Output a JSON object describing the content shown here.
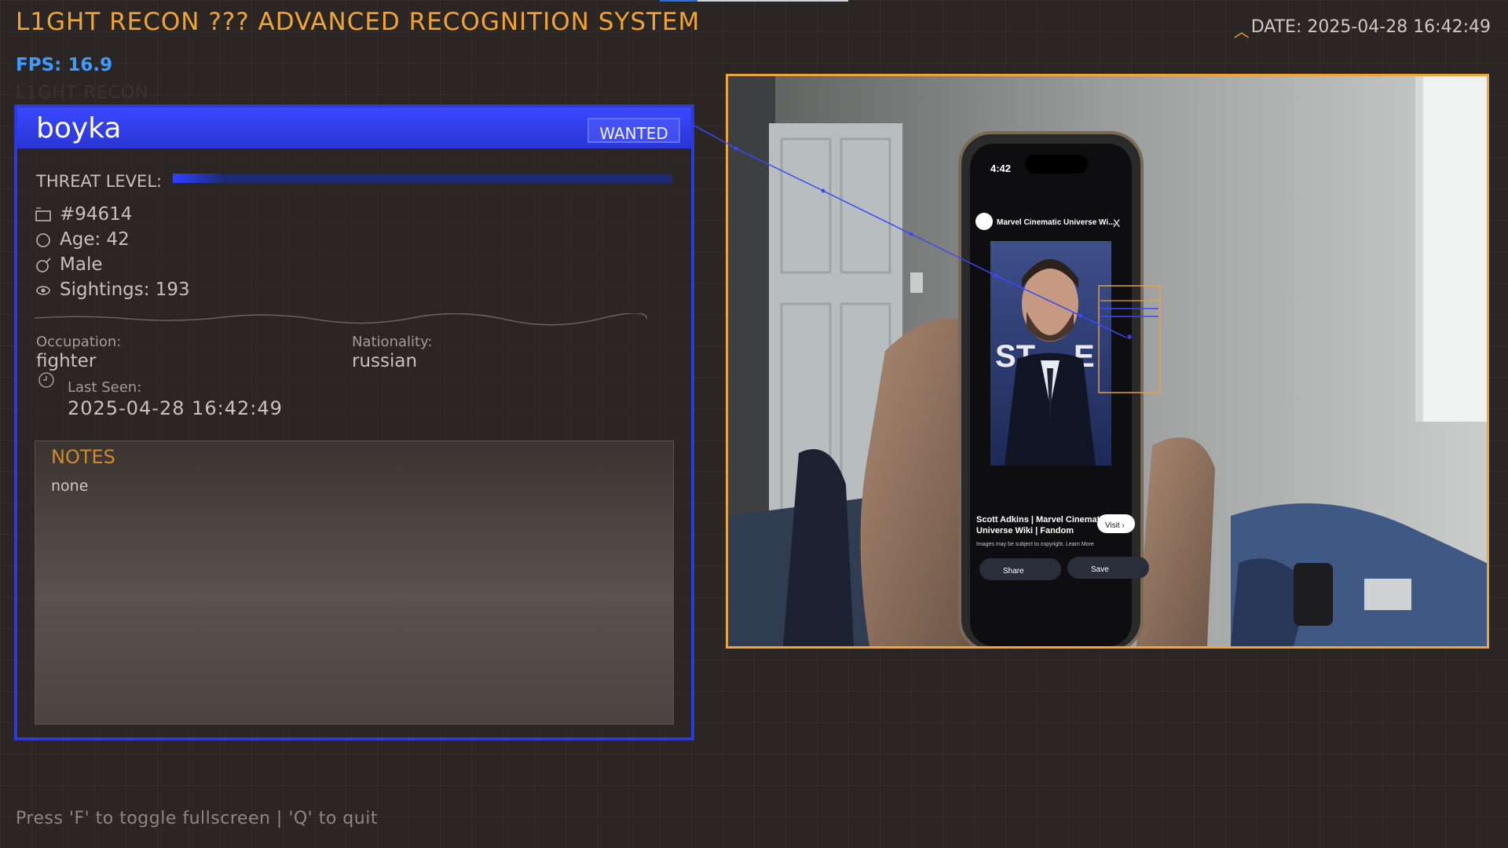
{
  "header": {
    "title": "L1GHT RECON ??? ADVANCED RECOGNITION SYSTEM",
    "date": "DATE: 2025-04-28 16:42:49"
  },
  "status": {
    "fps": "FPS: 16.9",
    "ghost_label": "L1GHT RECON"
  },
  "profile": {
    "name": "boyka",
    "badge": "WANTED",
    "threat_label": "THREAT LEVEL:",
    "threat_level": 0.1,
    "id": "#94614",
    "age": "Age: 42",
    "gender": "Male",
    "sightings": "Sightings: 193",
    "occupation_label": "Occupation:",
    "occupation": "fighter",
    "nationality_label": "Nationality:",
    "nationality": "russian",
    "last_seen_label": "Last Seen:",
    "last_seen": "2025-04-28 16:42:49",
    "notes_title": "NOTES",
    "notes": "none"
  },
  "camera": {
    "phone_time": "4:42",
    "browser_title": "Marvel Cinematic Universe Wi...",
    "close_glyph": "X",
    "poster_letters": "ST",
    "poster_letters_right": "E",
    "caption": "Scott Adkins | Marvel Cinematic Universe Wiki | Fandom",
    "caption_line1": "Scott Adkins | Marvel Cinematic",
    "caption_line2": "Universe Wiki | Fandom",
    "copyright": "Images may be subject to copyright. Learn More",
    "visit_label": "Visit ›",
    "share_label": "Share",
    "save_label": "Save"
  },
  "footer": {
    "hint": "Press 'F' to toggle fullscreen | 'Q' to quit"
  },
  "colors": {
    "accent_orange": "#f0a436",
    "accent_blue": "#2d39d8",
    "fps_blue": "#3f9bff",
    "background": "#2b2624"
  },
  "icons": [
    "id-card-icon",
    "age-circle-icon",
    "male-icon",
    "eye-icon",
    "clock-icon"
  ]
}
